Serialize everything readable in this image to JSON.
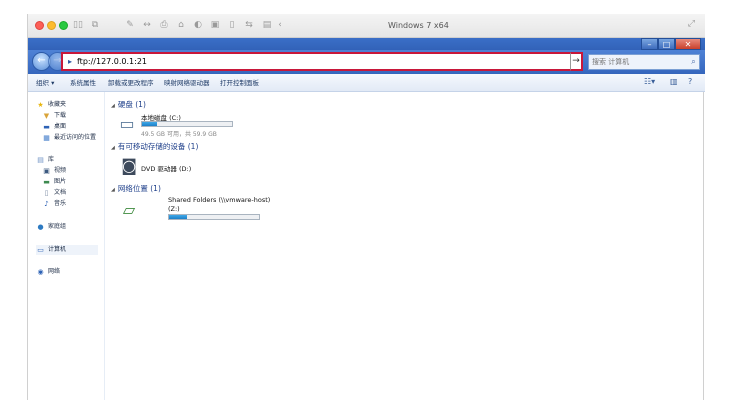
{
  "mac_titlebar": {
    "title": "Windows 7 x64",
    "fullscreen_icon": "fullscreen-icon"
  },
  "window_controls": {
    "minimize": "–",
    "maximize": "□",
    "close": "✕"
  },
  "address": {
    "value": "ftp://127.0.0.1:21",
    "go_arrow": "→"
  },
  "search": {
    "placeholder": "搜索 计算机"
  },
  "commands": {
    "organize": "组织 ▾",
    "system_properties": "系统属性",
    "uninstall": "卸载或更改程序",
    "map_drive": "映射网络驱动器",
    "control_panel": "打开控制面板"
  },
  "nav_pane": {
    "favorites": "收藏夹",
    "downloads": "下载",
    "desktop": "桌面",
    "recent": "最近访问的位置",
    "libraries": "库",
    "videos": "视频",
    "pictures": "图片",
    "documents": "文档",
    "music": "音乐",
    "homegroup": "家庭组",
    "computer": "计算机",
    "network": "网络"
  },
  "groups": {
    "hard_disks": "硬盘 (1)",
    "removable": "有可移动存储的设备 (1)",
    "network_locations": "网络位置 (1)"
  },
  "drives": {
    "c_name": "本地磁盘 (C:)",
    "c_free": "49.5 GB 可用，共 59.9 GB",
    "c_used_fraction": 0.17,
    "dvd_name": "DVD 驱动器 (D:)",
    "shared_name": "Shared Folders (\\\\vmware-host)",
    "shared_letter": "(Z:)",
    "shared_used_fraction": 0.2
  },
  "colors": {
    "accent": "#c8173a",
    "caption": "#3566bd"
  }
}
